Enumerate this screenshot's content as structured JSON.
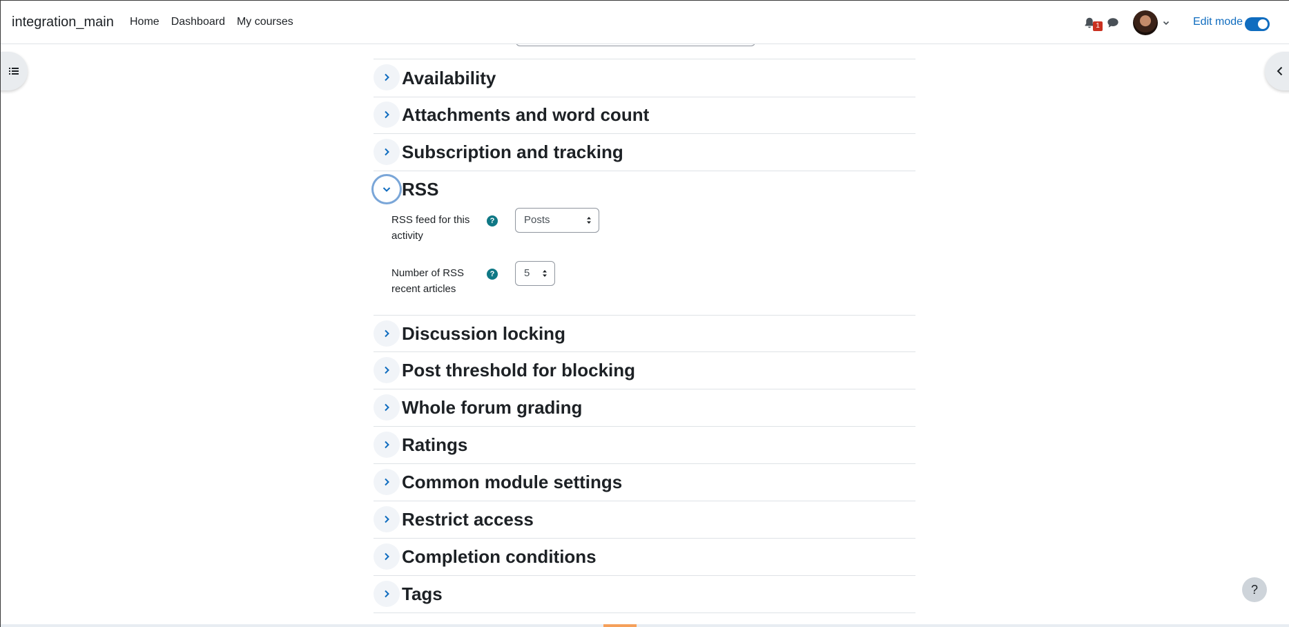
{
  "navbar": {
    "brand": "integration_main",
    "links": [
      "Home",
      "Dashboard",
      "My courses"
    ],
    "notification_count": "1",
    "edit_mode_label": "Edit mode"
  },
  "help_button": "?",
  "sections": [
    {
      "title": "Availability",
      "expanded": false
    },
    {
      "title": "Attachments and word count",
      "expanded": false
    },
    {
      "title": "Subscription and tracking",
      "expanded": false
    },
    {
      "title": "RSS",
      "expanded": true
    },
    {
      "title": "Discussion locking",
      "expanded": false
    },
    {
      "title": "Post threshold for blocking",
      "expanded": false
    },
    {
      "title": "Whole forum grading",
      "expanded": false
    },
    {
      "title": "Ratings",
      "expanded": false
    },
    {
      "title": "Common module settings",
      "expanded": false
    },
    {
      "title": "Restrict access",
      "expanded": false
    },
    {
      "title": "Completion conditions",
      "expanded": false
    },
    {
      "title": "Tags",
      "expanded": false
    }
  ],
  "rss": {
    "feed_label": "RSS feed for this activity",
    "feed_value": "Posts",
    "count_label": "Number of RSS recent articles",
    "count_value": "5",
    "help_glyph": "?"
  },
  "icons": {
    "bell": "bell-icon",
    "chat": "chat-icon",
    "chevron_right": "chevron-right-icon",
    "chevron_down": "chevron-down-icon",
    "list": "list-icon",
    "chevron_left": "chevron-left-icon"
  },
  "colors": {
    "accent": "#0f6cbf",
    "badge": "#ca3120",
    "help": "#0f7885"
  }
}
